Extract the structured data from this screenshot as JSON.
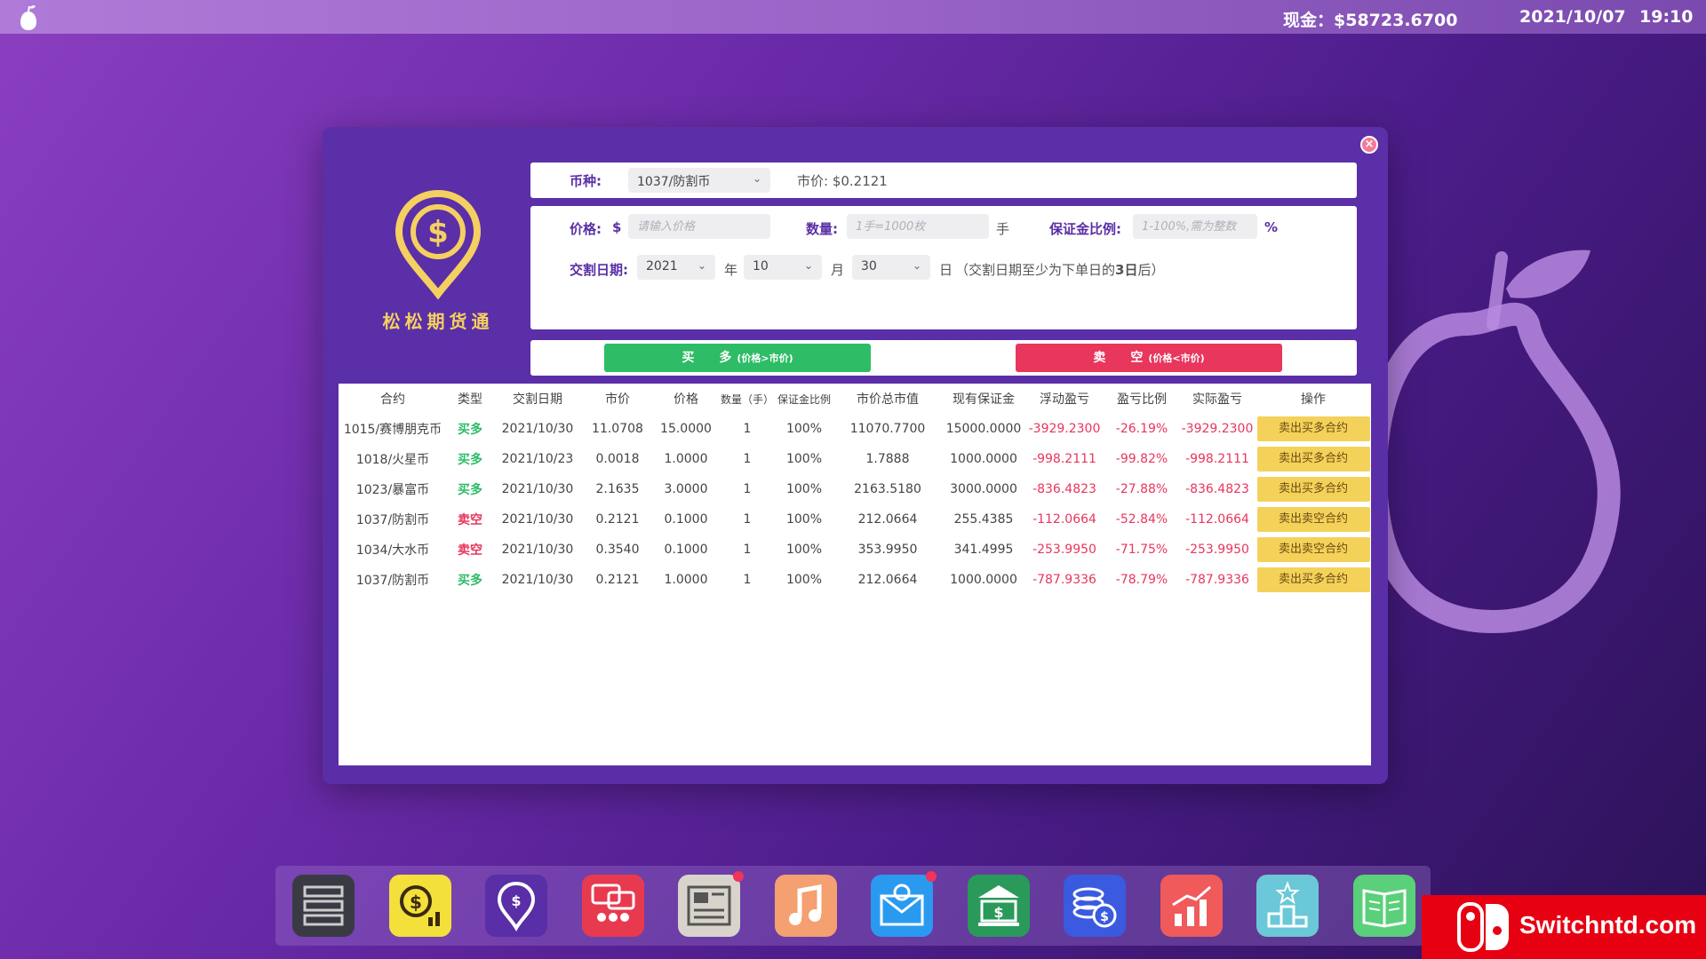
{
  "topbar": {
    "cash": "现金：$58723.6700",
    "date": "2021/10/07",
    "time": "19:10"
  },
  "app": {
    "title": "松松期货通",
    "close": "×"
  },
  "form": {
    "currency_label": "币种:",
    "currency_value": "1037/防割币",
    "market_price": "市价: $0.2121",
    "price_label": "价格:",
    "price_symbol": "$",
    "price_placeholder": "请输入价格",
    "qty_label": "数量:",
    "qty_placeholder": "1手=1000枚",
    "qty_unit": "手",
    "margin_label": "保证金比例:",
    "margin_placeholder": "1-100%,需为整数",
    "margin_unit": "%",
    "delivery_label": "交割日期:",
    "year_value": "2021",
    "year_unit": "年",
    "month_value": "10",
    "month_unit": "月",
    "day_value": "30",
    "day_unit": "日",
    "delivery_note_prefix": "（交割日期至少为下单日的",
    "delivery_note_bold": "3日",
    "delivery_note_suffix": "后）"
  },
  "actions": {
    "buy_label": "买　　多",
    "buy_hint": "(价格>市价)",
    "sell_label": "卖　　空",
    "sell_hint": "(价格<市价)"
  },
  "table": {
    "headers": [
      "合约",
      "类型",
      "交割日期",
      "市价",
      "价格",
      "数量（手）",
      "保证金比例",
      "市价总市值",
      "现有保证金",
      "浮动盈亏",
      "盈亏比例",
      "实际盈亏",
      "操作"
    ],
    "rows": [
      [
        "1015/赛博朋克币",
        "买多",
        "2021/10/30",
        "11.0708",
        "15.0000",
        "1",
        "100%",
        "11070.7700",
        "15000.0000",
        "-3929.2300",
        "-26.19%",
        "-3929.2300",
        "卖出买多合约"
      ],
      [
        "1018/火星币",
        "买多",
        "2021/10/23",
        "0.0018",
        "1.0000",
        "1",
        "100%",
        "1.7888",
        "1000.0000",
        "-998.2111",
        "-99.82%",
        "-998.2111",
        "卖出买多合约"
      ],
      [
        "1023/暴富币",
        "买多",
        "2021/10/30",
        "2.1635",
        "3.0000",
        "1",
        "100%",
        "2163.5180",
        "3000.0000",
        "-836.4823",
        "-27.88%",
        "-836.4823",
        "卖出买多合约"
      ],
      [
        "1037/防割币",
        "卖空",
        "2021/10/30",
        "0.2121",
        "0.1000",
        "1",
        "100%",
        "212.0664",
        "255.4385",
        "-112.0664",
        "-52.84%",
        "-112.0664",
        "卖出卖空合约"
      ],
      [
        "1034/大水币",
        "卖空",
        "2021/10/30",
        "0.3540",
        "0.1000",
        "1",
        "100%",
        "353.9950",
        "341.4995",
        "-253.9950",
        "-71.75%",
        "-253.9950",
        "卖出卖空合约"
      ],
      [
        "1037/防割币",
        "买多",
        "2021/10/30",
        "0.2121",
        "1.0000",
        "1",
        "100%",
        "212.0664",
        "1000.0000",
        "-787.9336",
        "-78.79%",
        "-787.9336",
        "卖出买多合约"
      ]
    ]
  },
  "dock": [
    {
      "name": "server-icon",
      "bg": "#3a3a44"
    },
    {
      "name": "finance-chart-icon",
      "bg": "#f4e03a"
    },
    {
      "name": "futures-icon",
      "bg": "#5a2ea6"
    },
    {
      "name": "forum-icon",
      "bg": "#e83a4e"
    },
    {
      "name": "news-icon",
      "bg": "#d8d4cc"
    },
    {
      "name": "music-icon",
      "bg": "#f4a070"
    },
    {
      "name": "mail-icon",
      "bg": "#2a9af0"
    },
    {
      "name": "bank-icon",
      "bg": "#2a9a5a"
    },
    {
      "name": "coins-icon",
      "bg": "#3a5ae0"
    },
    {
      "name": "stock-chart-icon",
      "bg": "#f05a5a"
    },
    {
      "name": "ranking-icon",
      "bg": "#6ac8d8"
    },
    {
      "name": "book-icon",
      "bg": "#5ad07a"
    }
  ],
  "watermark": {
    "text": "Switchntd.com"
  }
}
